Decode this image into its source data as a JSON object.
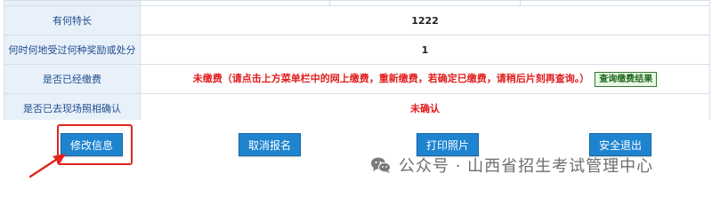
{
  "rows": [
    {
      "label": "有何特长",
      "value": "1222"
    },
    {
      "label": "何时何地受过何种奖励或处分",
      "value": "1"
    },
    {
      "label": "是否已经缴费",
      "value": "未缴费（请点击上方菜单栏中的网上缴费，重新缴费，若确定已缴费，请稍后片刻再查询。）",
      "action": "查询缴费结果"
    },
    {
      "label": "是否已去现场照相确认",
      "value": "未确认"
    }
  ],
  "buttons": {
    "modify": "修改信息",
    "cancel": "取消报名",
    "print": "打印照片",
    "exit": "安全退出"
  },
  "watermark": {
    "text": "公众号 · 山西省招生考试管理中心",
    "icon": "wechat-icon"
  },
  "colors": {
    "button": "#1e84d0",
    "label_text": "#1f4e8c",
    "alert_text": "#e11b1b",
    "highlight": "#e3231d",
    "query_button_border": "#2f7a2f"
  }
}
